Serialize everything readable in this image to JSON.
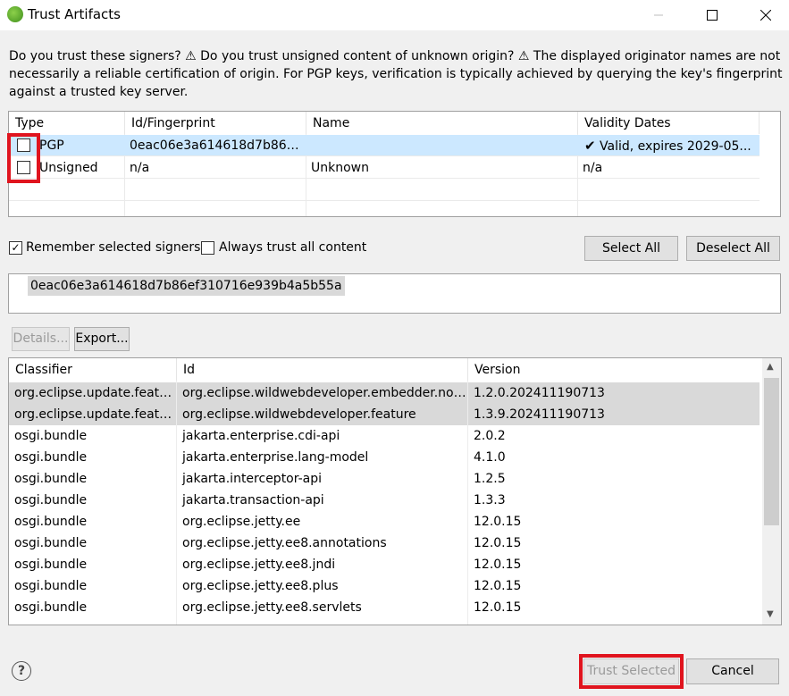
{
  "window": {
    "title": "Trust Artifacts"
  },
  "message": "Do you trust these signers? ⚠ Do you trust unsigned content of unknown origin? ⚠ The displayed originator names are not necessarily a reliable certification of origin. For PGP keys, verification is typically achieved by querying the key's fingerprint against a trusted key server.",
  "signers": {
    "columns": [
      "Type",
      "Id/Fingerprint",
      "Name",
      "Validity Dates"
    ],
    "rows": [
      {
        "type": "PGP",
        "id": "0eac06e3a614618d7b86ef...",
        "name": "",
        "validity": "Valid, expires 2029-05...",
        "checked": false,
        "selected": true
      },
      {
        "type": "Unsigned",
        "id": "n/a",
        "name": "Unknown",
        "validity": "n/a",
        "checked": false,
        "selected": false
      }
    ]
  },
  "options": {
    "remember_label": "Remember selected signers",
    "remember_checked": true,
    "always_trust_label": "Always trust all content",
    "always_trust_checked": false
  },
  "buttons": {
    "select_all": "Select All",
    "deselect_all": "Deselect All",
    "details": "Details...",
    "export": "Export...",
    "trust_selected": "Trust Selected",
    "cancel": "Cancel"
  },
  "fingerprint": "0eac06e3a614618d7b86ef310716e939b4a5b55a",
  "artifacts": {
    "columns": [
      "Classifier",
      "Id",
      "Version"
    ],
    "rows": [
      {
        "classifier": "org.eclipse.update.feature",
        "id": "org.eclipse.wildwebdeveloper.embedder.nod...",
        "version": "1.2.0.202411190713",
        "selected": true
      },
      {
        "classifier": "org.eclipse.update.feature",
        "id": "org.eclipse.wildwebdeveloper.feature",
        "version": "1.3.9.202411190713",
        "selected": true
      },
      {
        "classifier": "osgi.bundle",
        "id": "jakarta.enterprise.cdi-api",
        "version": "2.0.2",
        "selected": false
      },
      {
        "classifier": "osgi.bundle",
        "id": "jakarta.enterprise.lang-model",
        "version": "4.1.0",
        "selected": false
      },
      {
        "classifier": "osgi.bundle",
        "id": "jakarta.interceptor-api",
        "version": "1.2.5",
        "selected": false
      },
      {
        "classifier": "osgi.bundle",
        "id": "jakarta.transaction-api",
        "version": "1.3.3",
        "selected": false
      },
      {
        "classifier": "osgi.bundle",
        "id": "org.eclipse.jetty.ee",
        "version": "12.0.15",
        "selected": false
      },
      {
        "classifier": "osgi.bundle",
        "id": "org.eclipse.jetty.ee8.annotations",
        "version": "12.0.15",
        "selected": false
      },
      {
        "classifier": "osgi.bundle",
        "id": "org.eclipse.jetty.ee8.jndi",
        "version": "12.0.15",
        "selected": false
      },
      {
        "classifier": "osgi.bundle",
        "id": "org.eclipse.jetty.ee8.plus",
        "version": "12.0.15",
        "selected": false
      },
      {
        "classifier": "osgi.bundle",
        "id": "org.eclipse.jetty.ee8.servlets",
        "version": "12.0.15",
        "selected": false
      }
    ]
  },
  "colors": {
    "selection": "#cce8ff",
    "grey_selection": "#d9d9d9",
    "highlight": "#e0141e"
  },
  "icons": {
    "help": "?"
  }
}
